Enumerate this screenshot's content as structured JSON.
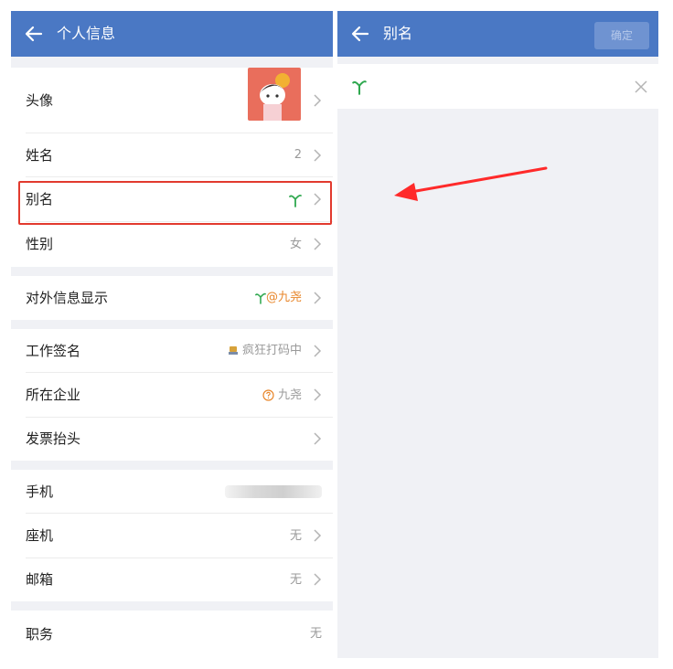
{
  "left": {
    "title": "个人信息",
    "rows": {
      "avatar": {
        "label": "头像"
      },
      "name": {
        "label": "姓名",
        "value": "2"
      },
      "alias": {
        "label": "别名"
      },
      "gender": {
        "label": "性别",
        "value": "女"
      },
      "external": {
        "label": "对外信息显示",
        "value": "@九尧"
      },
      "signature": {
        "label": "工作签名",
        "value": "疯狂打码中"
      },
      "company": {
        "label": "所在企业",
        "value": "九尧"
      },
      "invoice": {
        "label": "发票抬头"
      },
      "mobile": {
        "label": "手机"
      },
      "phone": {
        "label": "座机",
        "value": "无"
      },
      "email": {
        "label": "邮箱",
        "value": "无"
      },
      "job": {
        "label": "职务",
        "value": "无"
      }
    }
  },
  "right": {
    "title": "别名",
    "confirm_label": "确定"
  },
  "colors": {
    "header": "#4a78c4",
    "highlight": "#e23a2e",
    "arrow": "#ff2a2a",
    "sprout": "#2fa84f",
    "accent": "#e8862a"
  },
  "icons": [
    "back-arrow-icon",
    "chevron-right-icon",
    "sprout-icon",
    "badge-icon",
    "question-circle-icon",
    "clear-icon"
  ]
}
